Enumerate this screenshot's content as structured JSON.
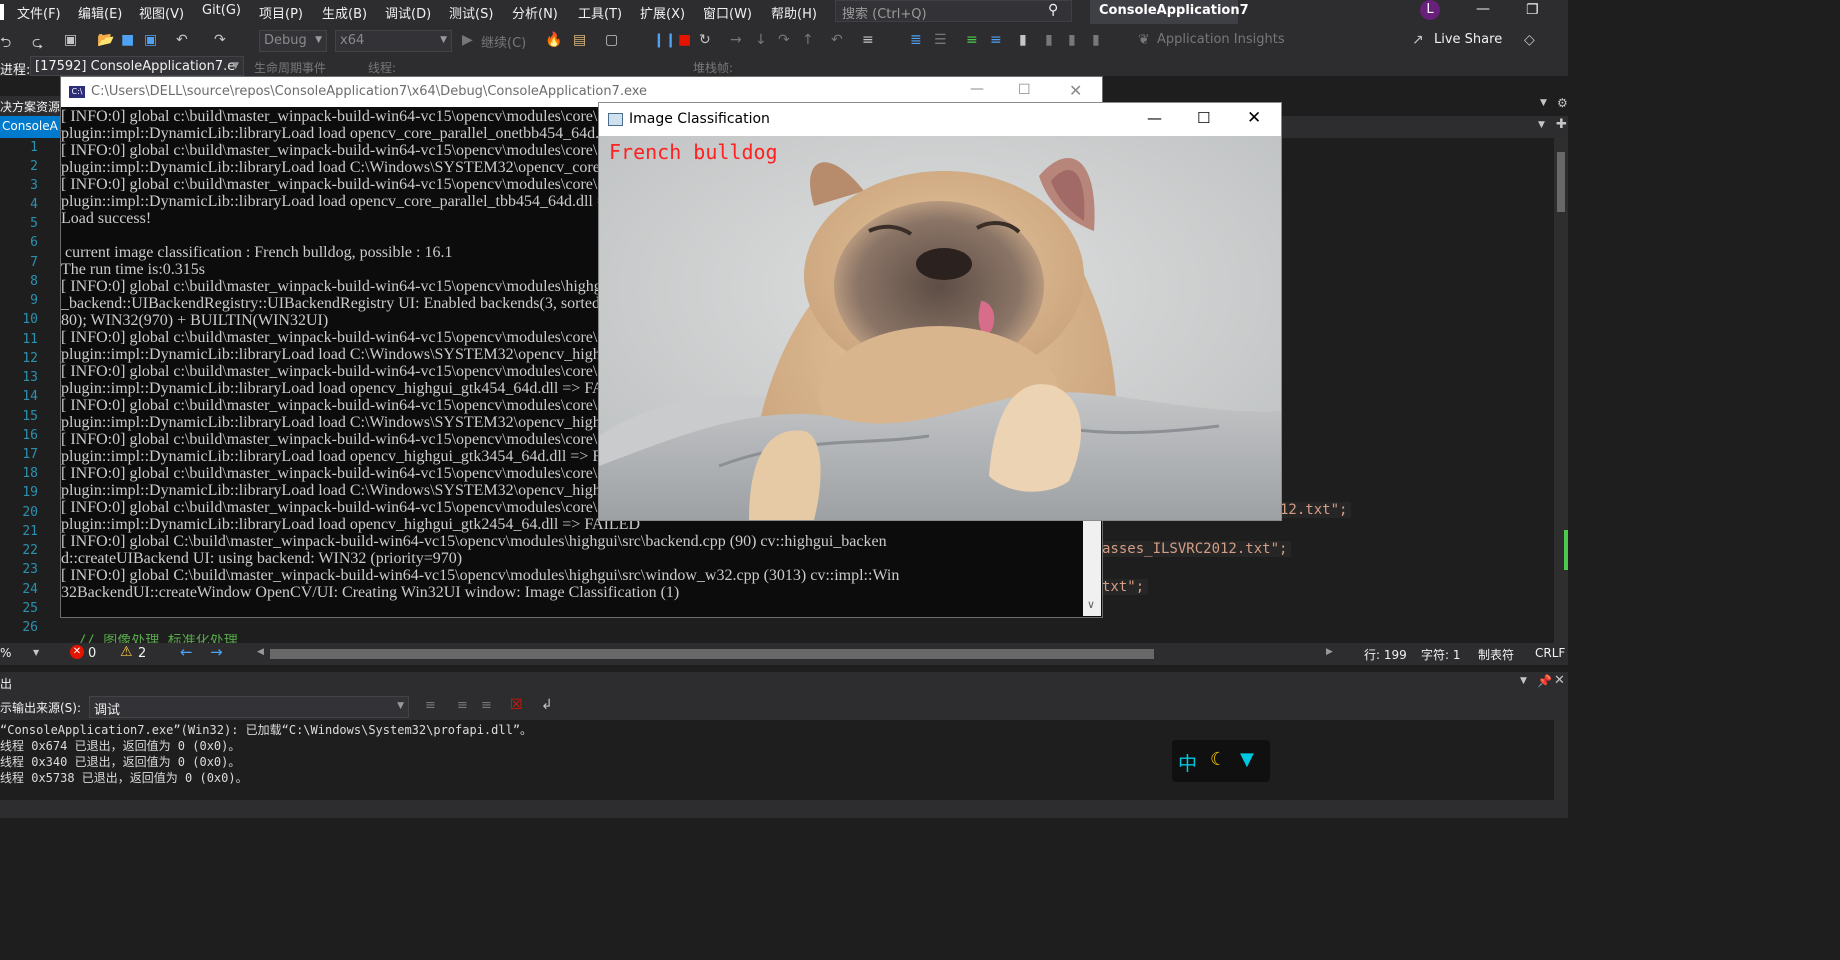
{
  "menu": {
    "items": [
      "文件(F)",
      "编辑(E)",
      "视图(V)",
      "Git(G)",
      "项目(P)",
      "生成(B)",
      "调试(D)",
      "测试(S)",
      "分析(N)",
      "工具(T)",
      "扩展(X)",
      "窗口(W)",
      "帮助(H)"
    ],
    "search_placeholder": "搜索 (Ctrl+Q)",
    "project_title": "ConsoleApplication7",
    "avatar_initial": "L"
  },
  "toolbar": {
    "config": "Debug",
    "platform": "x64",
    "continue_label": "继续(C)",
    "insights_label": "Application Insights",
    "live_share": "Live Share"
  },
  "process_bar": {
    "process_label": "进程:",
    "process_value": "[17592] ConsoleApplication7.e",
    "lifecycle_label": "生命周期事件",
    "thread_label": "线程:",
    "stackframe_label": "堆栈帧:"
  },
  "side": {
    "solution_label": "决方案资源",
    "tab_label": "ConsoleA"
  },
  "gutter": {
    "lines": [
      "1",
      "2",
      "3",
      "4",
      "5",
      "6",
      "7",
      "8",
      "9",
      "10",
      "11",
      "12",
      "13",
      "14",
      "15",
      "16",
      "17",
      "18",
      "19",
      "20",
      "21",
      "22",
      "23",
      "24",
      "25",
      "26"
    ]
  },
  "editor": {
    "fragments": [
      "12.txt\";",
      "asses_ILSVRC2012.txt\";",
      "txt\";"
    ],
    "comment_partial": "// 图像处理  标准化处理"
  },
  "console": {
    "title": "C:\\Users\\DELL\\source\\repos\\ConsoleApplication7\\x64\\Debug\\ConsoleApplication7.exe",
    "lines": [
      "[ INFO:0] global c:\\build\\master_winpack-build-win64-vc15\\opencv\\modules\\core\\src\\utils\\plugin_loader.impl.hpp (67) cv::",
      "plugin::impl::DynamicLib::libraryLoad load opencv_core_parallel_onetbb454_64d.dll => FAILED",
      "[ INFO:0] global c:\\build\\master_winpack-build-win64-vc15\\opencv\\modules\\core\\src\\utils\\plugin_loader.impl.hpp (67) cv::",
      "plugin::impl::DynamicLib::libraryLoad load C:\\Windows\\SYSTEM32\\opencv_core_parallel_tbb454_64d.dll => FAILED",
      "[ INFO:0] global c:\\build\\master_winpack-build-win64-vc15\\opencv\\modules\\core\\src\\utils\\plugin_loader.impl.hpp (67) cv::",
      "plugin::impl::DynamicLib::libraryLoad load opencv_core_parallel_tbb454_64d.dll => FAILED",
      "Load success!",
      "",
      " current image classification : French bulldog, possible : 16.1",
      "The run time is:0.315s",
      "[ INFO:0] global c:\\build\\master_winpack-build-win64-vc15\\opencv\\modules\\highgui\\src\\registry.impl.hpp (114) cv::highgui",
      "_backend::UIBackendRegistry::UIBackendRegistry UI: Enabled backends(3, sorted by priority): GTK(1000); GTK3(990); GTK2(9",
      "80); WIN32(970) + BUILTIN(WIN32UI)",
      "[ INFO:0] global c:\\build\\master_winpack-build-win64-vc15\\opencv\\modules\\core\\src\\utils\\plugin_loader.impl.hpp (67) cv::",
      "plugin::impl::DynamicLib::libraryLoad load C:\\Windows\\SYSTEM32\\opencv_highgui_gtk454_64d.dll => FAILED",
      "[ INFO:0] global c:\\build\\master_winpack-build-win64-vc15\\opencv\\modules\\core\\src\\utils\\plugin_loader.impl.hpp (67) cv::",
      "plugin::impl::DynamicLib::libraryLoad load opencv_highgui_gtk454_64d.dll => FAILED",
      "[ INFO:0] global c:\\build\\master_winpack-build-win64-vc15\\opencv\\modules\\core\\src\\utils\\plugin_loader.impl.hpp (67) cv::",
      "plugin::impl::DynamicLib::libraryLoad load C:\\Windows\\SYSTEM32\\opencv_highgui_gtk3454_64d.dll => FAILED",
      "[ INFO:0] global c:\\build\\master_winpack-build-win64-vc15\\opencv\\modules\\core\\src\\utils\\plugin_loader.impl.hpp (67) cv::",
      "plugin::impl::DynamicLib::libraryLoad load opencv_highgui_gtk3454_64d.dll => FAILED",
      "[ INFO:0] global c:\\build\\master_winpack-build-win64-vc15\\opencv\\modules\\core\\src\\utils\\plugin_loader.impl.hpp (67) cv::",
      "plugin::impl::DynamicLib::libraryLoad load C:\\Windows\\SYSTEM32\\opencv_highgui_gtk2454_64d.dll => FAILED",
      "[ INFO:0] global c:\\build\\master_winpack-build-win64-vc15\\opencv\\modules\\core\\src\\utils\\plugin_loader.impl.hpp (67) cv::",
      "plugin::impl::DynamicLib::libraryLoad load opencv_highgui_gtk2454_64.dll => FAILED",
      "[ INFO:0] global C:\\build\\master_winpack-build-win64-vc15\\opencv\\modules\\highgui\\src\\backend.cpp (90) cv::highgui_backen",
      "d::createUIBackend UI: using backend: WIN32 (priority=970)",
      "[ INFO:0] global C:\\build\\master_winpack-build-win64-vc15\\opencv\\modules\\highgui\\src\\window_w32.cpp (3013) cv::impl::Win",
      "32BackendUI::createWindow OpenCV/UI: Creating Win32UI window: Image Classification (1)"
    ]
  },
  "image_window": {
    "title": "Image Classification",
    "prediction_label": "French bulldog"
  },
  "status": {
    "zoom": "%",
    "errors": "0",
    "warnings": "2",
    "row": "行: 199",
    "col": "字符: 1",
    "tab_mode": "制表符",
    "line_ending": "CRLF"
  },
  "output": {
    "header": "出",
    "source_label": "示输出来源(S):",
    "source_value": "调试",
    "lines": [
      "“ConsoleApplication7.exe”(Win32): 已加载“C:\\Windows\\System32\\profapi.dll”。",
      "线程 0x674 已退出，返回值为 0 (0x0)。",
      "线程 0x340 已退出，返回值为 0 (0x0)。",
      "线程 0x5738 已退出，返回值为 0 (0x0)。"
    ]
  },
  "ime": {
    "lang": "中"
  }
}
